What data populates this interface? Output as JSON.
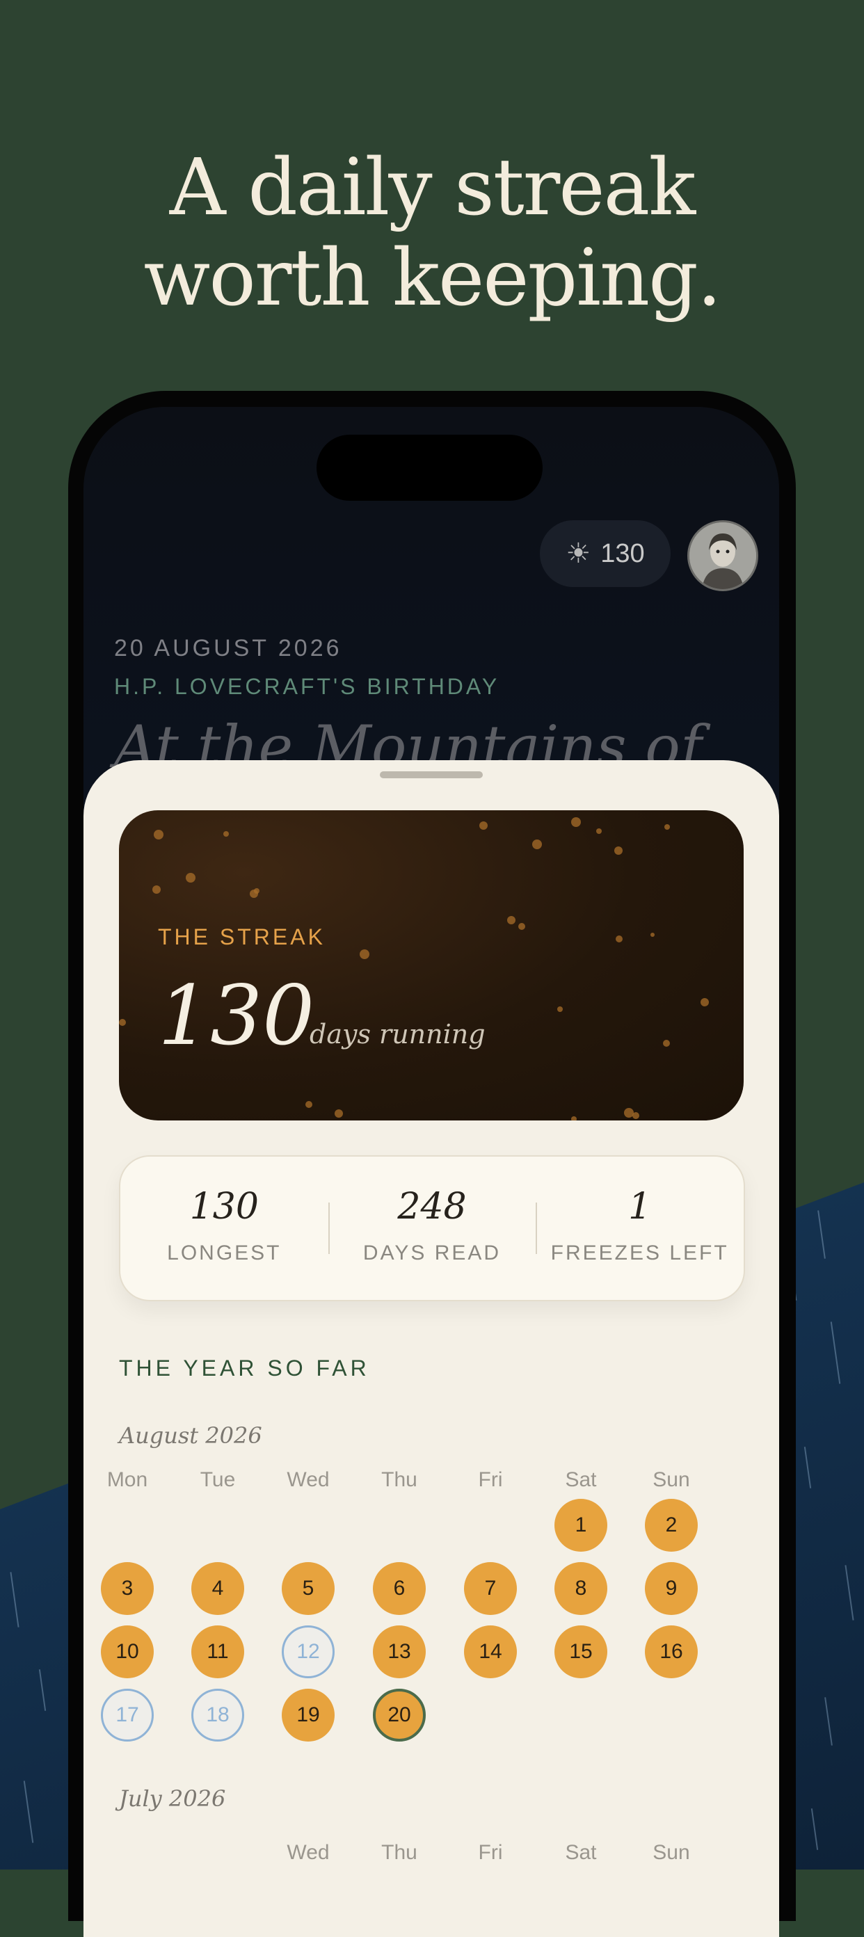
{
  "headline": {
    "highlight": "daily streak",
    "prefix": "A ",
    "line2": "worth keeping."
  },
  "status": {
    "streak_count": "130",
    "sun_icon": "sun-icon"
  },
  "today": {
    "date": "20 AUGUST 2026",
    "occasion": "H.P. LOVECRAFT'S BIRTHDAY",
    "book_title": "At the Mountains of"
  },
  "streak_card": {
    "label": "THE STREAK",
    "value": "130",
    "unit": "days running"
  },
  "stats": [
    {
      "value": "130",
      "label": "LONGEST"
    },
    {
      "value": "248",
      "label": "DAYS READ"
    },
    {
      "value": "1",
      "label": "FREEZES LEFT"
    }
  ],
  "calendar": {
    "section_title": "THE YEAR SO FAR",
    "weekdays": [
      "Mon",
      "Tue",
      "Wed",
      "Thu",
      "Fri",
      "Sat",
      "Sun"
    ],
    "months": [
      {
        "name": "August 2026",
        "days": [
          {
            "d": "1",
            "s": "read"
          },
          {
            "d": "2",
            "s": "read"
          },
          {
            "d": "3",
            "s": "read"
          },
          {
            "d": "4",
            "s": "read"
          },
          {
            "d": "5",
            "s": "read"
          },
          {
            "d": "6",
            "s": "read"
          },
          {
            "d": "7",
            "s": "read"
          },
          {
            "d": "8",
            "s": "read"
          },
          {
            "d": "9",
            "s": "read"
          },
          {
            "d": "10",
            "s": "read"
          },
          {
            "d": "11",
            "s": "read"
          },
          {
            "d": "12",
            "s": "frozen"
          },
          {
            "d": "13",
            "s": "read"
          },
          {
            "d": "14",
            "s": "read"
          },
          {
            "d": "15",
            "s": "read"
          },
          {
            "d": "16",
            "s": "read"
          },
          {
            "d": "17",
            "s": "frozen"
          },
          {
            "d": "18",
            "s": "frozen"
          },
          {
            "d": "19",
            "s": "read"
          },
          {
            "d": "20",
            "s": "today"
          }
        ]
      },
      {
        "name": "July 2026",
        "visible_weekdays": [
          "Wed",
          "Thu",
          "Fri",
          "Sat",
          "Sun"
        ]
      }
    ]
  },
  "colors": {
    "accent": "#e7a33e",
    "frozen": "#8fb3d6",
    "brand_green": "#2d4331"
  }
}
